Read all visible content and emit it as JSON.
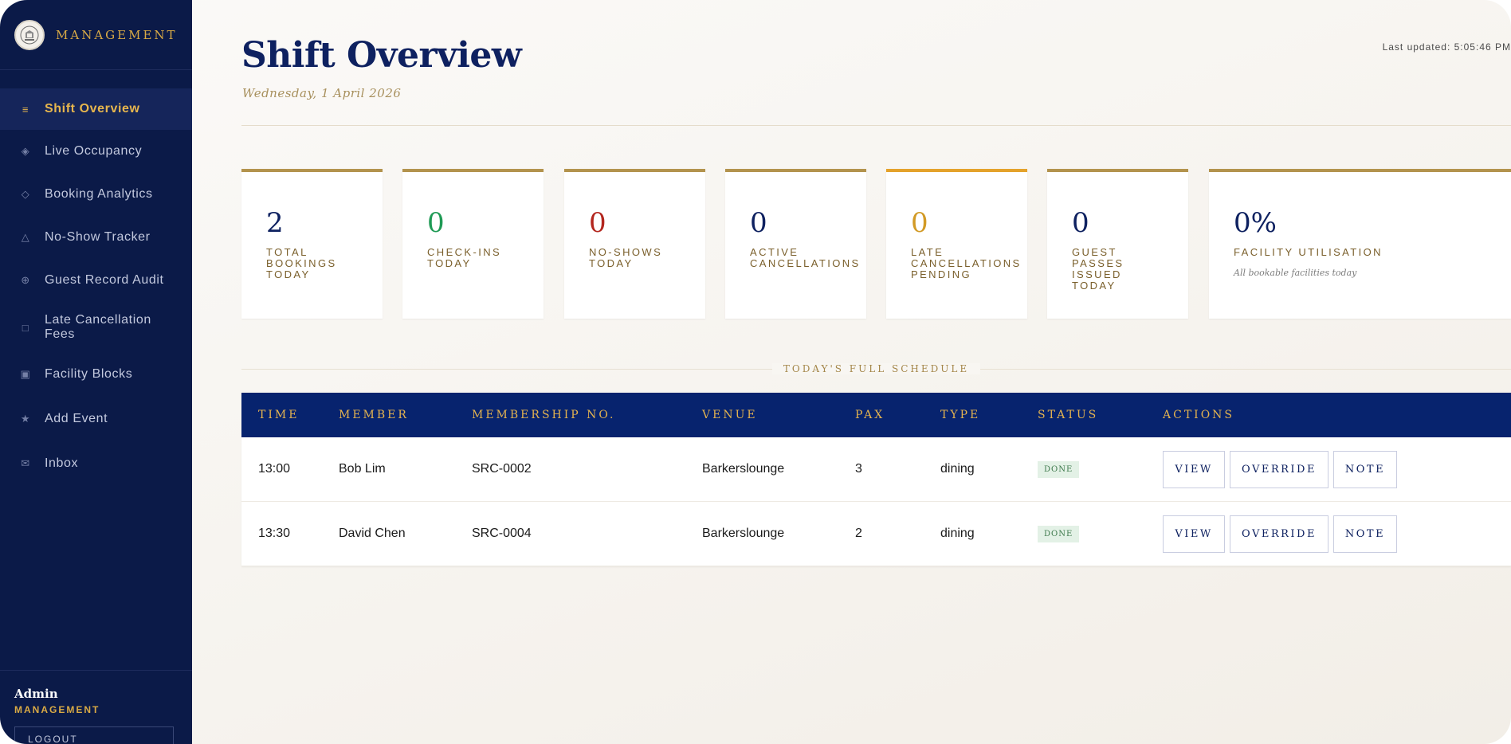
{
  "brand": {
    "title": "MANAGEMENT",
    "logo_icon": "crest-icon"
  },
  "sidebar": {
    "items": [
      {
        "label": "Shift Overview",
        "icon": "list-icon",
        "glyph": "≡",
        "active": true
      },
      {
        "label": "Live Occupancy",
        "icon": "diamond-dot-icon",
        "glyph": "◈",
        "active": false
      },
      {
        "label": "Booking Analytics",
        "icon": "diamond-icon",
        "glyph": "◇",
        "active": false
      },
      {
        "label": "No-Show Tracker",
        "icon": "triangle-icon",
        "glyph": "△",
        "active": false
      },
      {
        "label": "Guest Record Audit",
        "icon": "globe-icon",
        "glyph": "⊕",
        "active": false
      },
      {
        "label": "Late Cancellation Fees",
        "icon": "square-icon",
        "glyph": "□",
        "active": false
      },
      {
        "label": "Facility Blocks",
        "icon": "filled-square-icon",
        "glyph": "▣",
        "active": false
      },
      {
        "label": "Add Event",
        "icon": "star-icon",
        "glyph": "★",
        "active": false
      },
      {
        "label": "Inbox",
        "icon": "mail-icon",
        "glyph": "✉",
        "active": false
      }
    ],
    "footer": {
      "user": "Admin",
      "role": "MANAGEMENT",
      "logout_label": "LOGOUT"
    }
  },
  "header": {
    "title": "Shift Overview",
    "date": "Wednesday, 1 April 2026",
    "last_updated": "Last updated: 5:05:46 PM"
  },
  "stats": [
    {
      "value": "2",
      "label": "Total Bookings Today",
      "color": "#0e2160",
      "accent": "#b3934d"
    },
    {
      "value": "0",
      "label": "Check-ins Today",
      "color": "#1f9a55",
      "accent": "#b3934d"
    },
    {
      "value": "0",
      "label": "No-shows Today",
      "color": "#b3261e",
      "accent": "#b3934d"
    },
    {
      "value": "0",
      "label": "Active Cancellations",
      "color": "#0e2160",
      "accent": "#b3934d"
    },
    {
      "value": "0",
      "label": "Late Cancellations Pending",
      "color": "#d29a25",
      "accent": "#e4a22b"
    },
    {
      "value": "0",
      "label": "Guest Passes Issued Today",
      "color": "#0e2160",
      "accent": "#b3934d"
    },
    {
      "value": "0%",
      "label": "Facility Utilisation",
      "sub": "All bookable facilities today",
      "color": "#0e2160",
      "accent": "#b3934d"
    }
  ],
  "schedule": {
    "title": "TODAY'S FULL SCHEDULE",
    "columns": [
      "TIME",
      "MEMBER",
      "MEMBERSHIP NO.",
      "VENUE",
      "PAX",
      "TYPE",
      "STATUS",
      "ACTIONS"
    ],
    "rows": [
      {
        "time": "13:00",
        "member": "Bob Lim",
        "membership_no": "SRC-0002",
        "venue": "Barkerslounge",
        "pax": "3",
        "type": "dining",
        "status": "DONE"
      },
      {
        "time": "13:30",
        "member": "David Chen",
        "membership_no": "SRC-0004",
        "venue": "Barkerslounge",
        "pax": "2",
        "type": "dining",
        "status": "DONE"
      }
    ],
    "actions": {
      "view": "VIEW",
      "override": "OVERRIDE",
      "note": "NOTE"
    }
  }
}
